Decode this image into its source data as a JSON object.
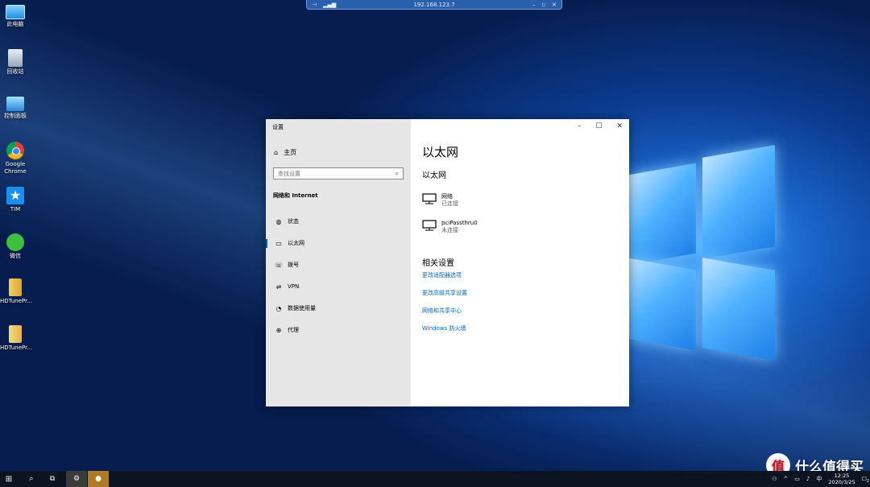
{
  "remote": {
    "title": "192.168.123.7"
  },
  "desktop_icons": [
    {
      "label": "此电脑"
    },
    {
      "label": "回收站"
    },
    {
      "label": "控制面板"
    },
    {
      "label": "Google Chrome"
    },
    {
      "label": "TIM"
    },
    {
      "label": "微信"
    },
    {
      "label": "HDTunePr..."
    },
    {
      "label": "HDTunePr..."
    }
  ],
  "settings": {
    "app_title": "设置",
    "home_label": "主页",
    "search_placeholder": "查找设置",
    "section_title": "网络和 Internet",
    "nav": [
      {
        "label": "状态",
        "icon": "globe-status-icon"
      },
      {
        "label": "以太网",
        "icon": "ethernet-icon"
      },
      {
        "label": "拨号",
        "icon": "dialup-icon"
      },
      {
        "label": "VPN",
        "icon": "vpn-icon"
      },
      {
        "label": "数据使用量",
        "icon": "data-usage-icon"
      },
      {
        "label": "代理",
        "icon": "proxy-globe-icon"
      }
    ],
    "page_title": "以太网",
    "subtitle": "以太网",
    "networks": [
      {
        "name": "网络",
        "status": "已连接"
      },
      {
        "name": "pciPassthru0",
        "status": "未连接"
      }
    ],
    "related_title": "相关设置",
    "links": [
      "更改适配器选项",
      "更改高级共享设置",
      "网络和共享中心",
      "Windows 防火墙"
    ]
  },
  "taskbar": {
    "time": "12:25",
    "date": "2020/3/25",
    "notification_count": "2"
  },
  "watermark": {
    "text": "什么值得买",
    "badge": "值"
  },
  "colors": {
    "accent": "#0063b1",
    "link": "#0067b8",
    "sidebar": "#e6e6e6"
  }
}
